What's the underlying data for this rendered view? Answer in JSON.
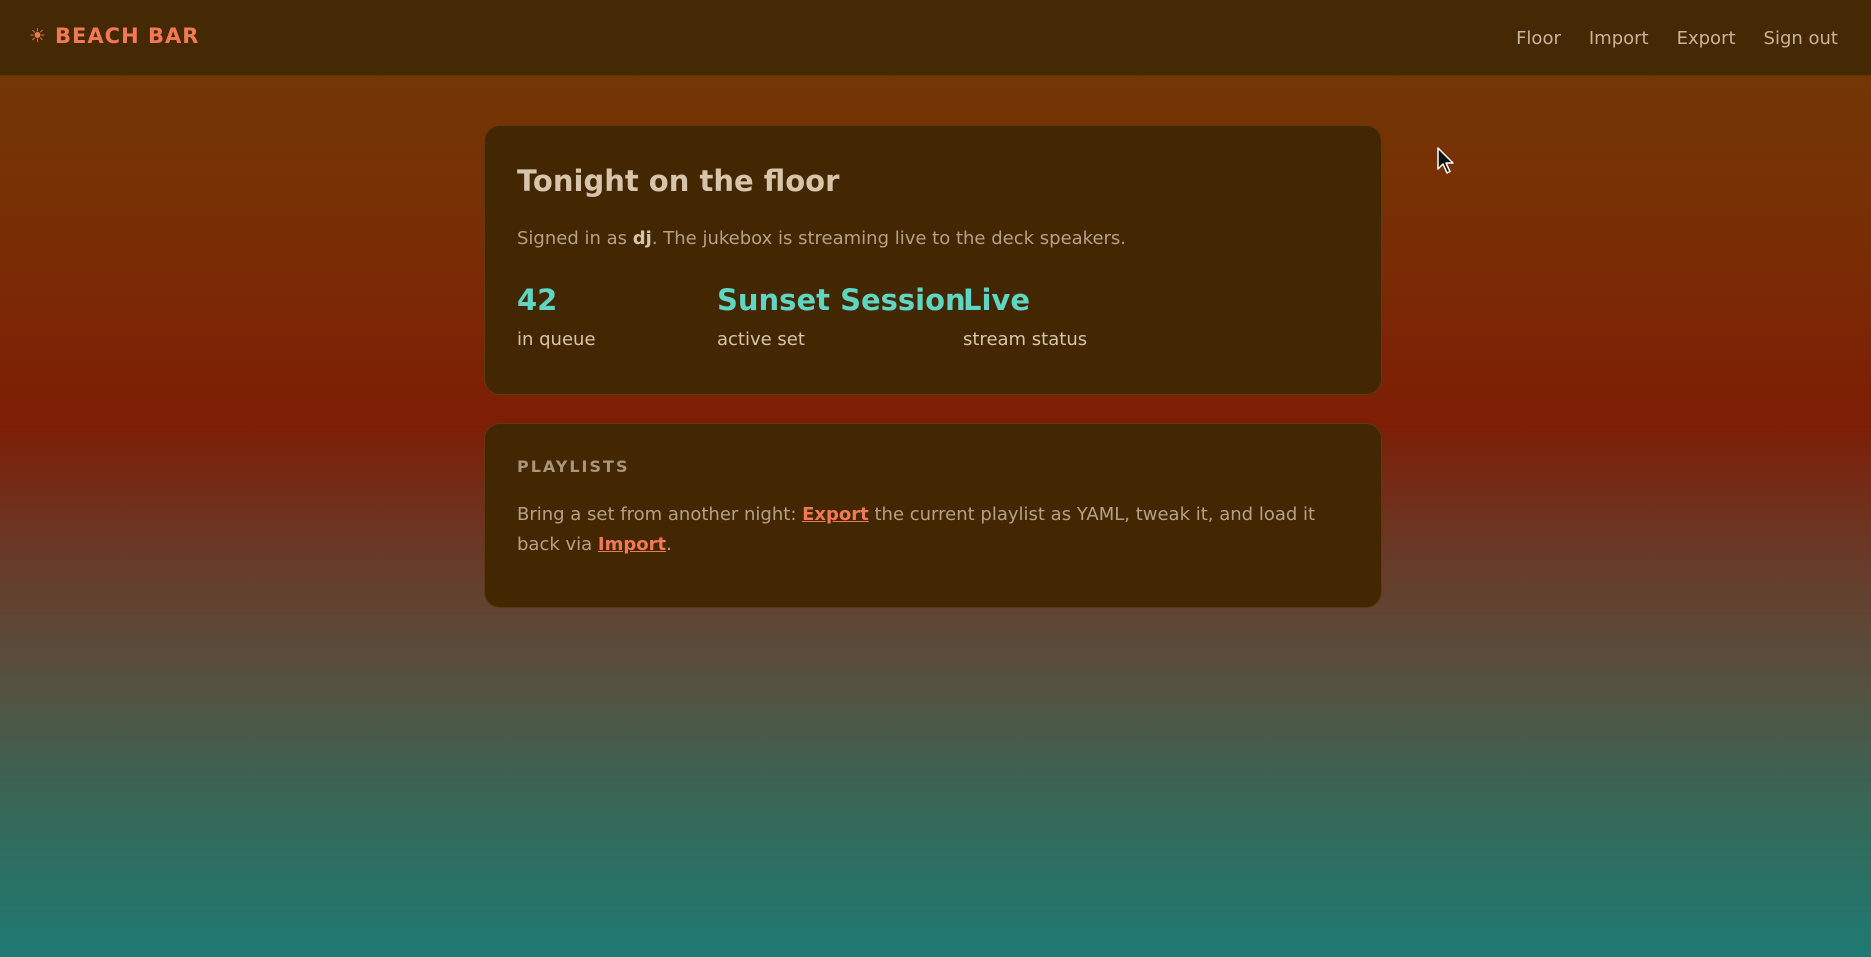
{
  "header": {
    "brand_icon": "sun-icon",
    "brand_symbol": "☀",
    "brand": "BEACH BAR",
    "nav": [
      "Floor",
      "Import",
      "Export",
      "Sign out"
    ]
  },
  "summary": {
    "title": "Tonight on the floor",
    "signed_in_prefix": "Signed in as ",
    "user": "dj",
    "signed_in_suffix": ". The jukebox is streaming live to the deck speakers.",
    "stats": [
      {
        "value": "42",
        "label": "in queue"
      },
      {
        "value": "Sunset Session",
        "label": "active set"
      },
      {
        "value": "Live",
        "label": "stream status"
      }
    ]
  },
  "playlists": {
    "heading": "PLAYLISTS",
    "text_1": "Bring a set from another night: ",
    "link_export": "Export",
    "text_2": " the current playlist as YAML, tweak it, and load it back via ",
    "link_import": "Import",
    "text_3": "."
  },
  "colors": {
    "accent": "#f07a55",
    "stat": "#5fd6c4",
    "card": "#432702",
    "topbar": "#452904"
  }
}
